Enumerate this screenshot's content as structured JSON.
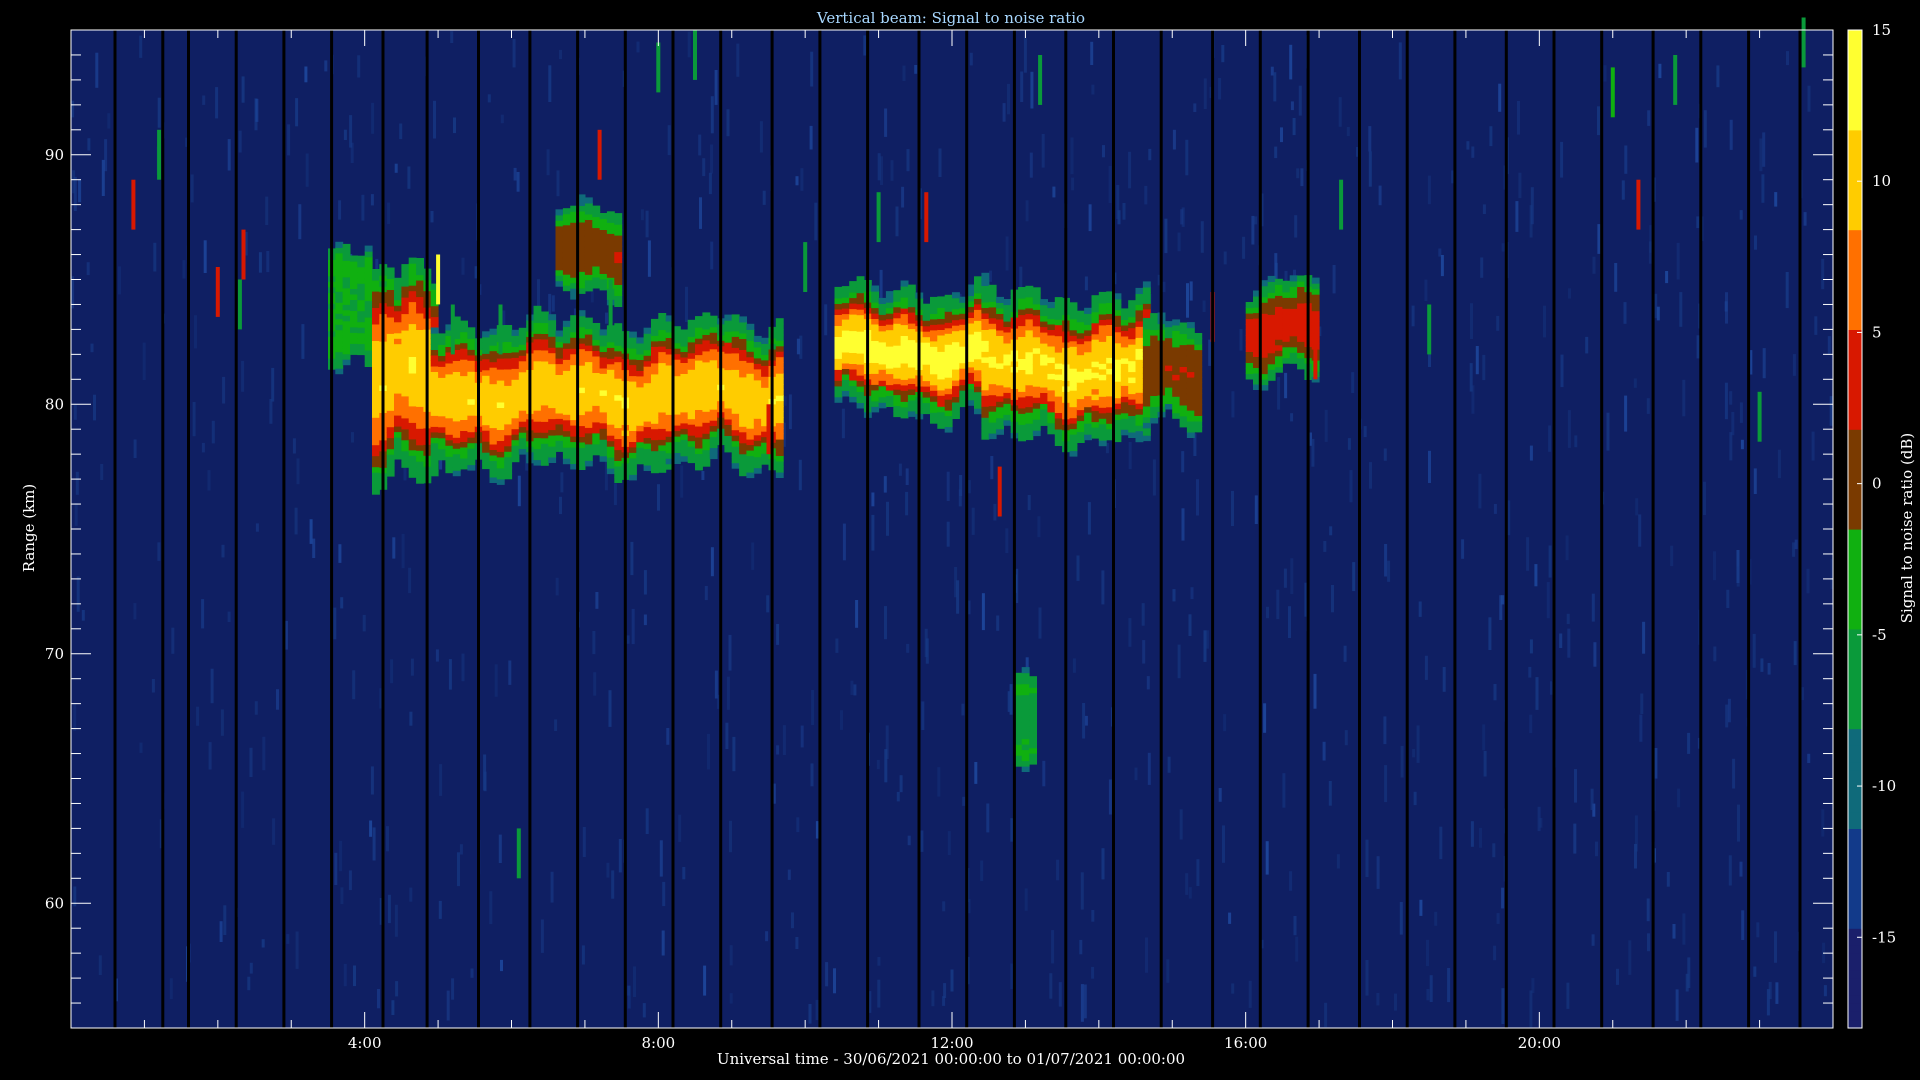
{
  "chart_data": {
    "type": "heatmap",
    "title": "Vertical beam: Signal to noise ratio",
    "xlabel": "Universal time - 30/06/2021 00:00:00 to 01/07/2021 00:00:00",
    "ylabel": "Range (km)",
    "colorbar_label": "Signal to noise ratio (dB)",
    "x_unit": "hours UT",
    "xlim": [
      0,
      24
    ],
    "ylim": [
      55,
      95
    ],
    "clim": [
      -18,
      15
    ],
    "x_ticks": [
      {
        "value": 4,
        "label": "4:00"
      },
      {
        "value": 8,
        "label": "8:00"
      },
      {
        "value": 12,
        "label": "12:00"
      },
      {
        "value": 16,
        "label": "16:00"
      },
      {
        "value": 20,
        "label": "20:00"
      }
    ],
    "y_ticks": [
      {
        "value": 60,
        "label": "60"
      },
      {
        "value": 70,
        "label": "70"
      },
      {
        "value": 80,
        "label": "80"
      },
      {
        "value": 90,
        "label": "90"
      }
    ],
    "colorbar_ticks": [
      {
        "value": 15,
        "label": "15"
      },
      {
        "value": 10,
        "label": "10"
      },
      {
        "value": 5,
        "label": "5"
      },
      {
        "value": 0,
        "label": "0"
      },
      {
        "value": -5,
        "label": "-5"
      },
      {
        "value": -10,
        "label": "-10"
      },
      {
        "value": -15,
        "label": "-15"
      }
    ],
    "colormap": [
      "#1a1f6b",
      "#123a8a",
      "#0f6a7a",
      "#0a9a3a",
      "#10b010",
      "#7a3a00",
      "#d81800",
      "#ff7000",
      "#ffcc00",
      "#ffff30"
    ],
    "background_color": "#0f1f63",
    "data_gaps_hours": [
      0.6,
      1.25,
      1.6,
      2.25,
      2.9,
      3.55,
      4.25,
      4.85,
      5.55,
      6.25,
      6.9,
      7.55,
      8.2,
      8.85,
      9.55,
      10.2,
      10.85,
      11.55,
      12.2,
      12.85,
      13.55,
      14.2,
      14.85,
      15.55,
      16.2,
      16.85,
      17.55,
      18.2,
      18.85,
      19.55,
      20.2,
      20.85,
      21.55,
      22.2,
      22.85,
      23.55
    ],
    "echo_regions": [
      {
        "t_start": 3.5,
        "t_end": 4.1,
        "range_center": 84.0,
        "half_thickness": 1.6,
        "peak_snr": -4
      },
      {
        "t_start": 4.1,
        "t_end": 4.9,
        "range_center": 81.0,
        "half_thickness": 3.2,
        "peak_snr": 12
      },
      {
        "t_start": 4.9,
        "t_end": 9.6,
        "range_center": 80.3,
        "half_thickness": 2.0,
        "peak_snr": 12
      },
      {
        "t_start": 6.6,
        "t_end": 7.4,
        "range_center": 86.0,
        "half_thickness": 1.2,
        "peak_snr": 2
      },
      {
        "t_start": 10.4,
        "t_end": 12.4,
        "range_center": 82.0,
        "half_thickness": 1.7,
        "peak_snr": 14
      },
      {
        "t_start": 12.4,
        "t_end": 14.6,
        "range_center": 81.4,
        "half_thickness": 2.0,
        "peak_snr": 13
      },
      {
        "t_start": 14.6,
        "t_end": 15.3,
        "range_center": 81.0,
        "half_thickness": 1.4,
        "peak_snr": 2
      },
      {
        "t_start": 16.0,
        "t_end": 16.95,
        "range_center": 82.8,
        "half_thickness": 1.3,
        "peak_snr": 5
      },
      {
        "t_start": 12.85,
        "t_end": 13.05,
        "range_center": 67.0,
        "half_thickness": 1.2,
        "peak_snr": -6
      }
    ],
    "meteor_streaks": [
      {
        "t": 0.85,
        "range": 88.0,
        "snr": 3
      },
      {
        "t": 1.2,
        "range": 90.0,
        "snr": -6
      },
      {
        "t": 2.0,
        "range": 84.5,
        "snr": 3
      },
      {
        "t": 2.35,
        "range": 86.0,
        "snr": 3
      },
      {
        "t": 2.3,
        "range": 84.0,
        "snr": -6
      },
      {
        "t": 5.0,
        "range": 85.0,
        "snr": 13
      },
      {
        "t": 5.2,
        "range": 83.0,
        "snr": -6
      },
      {
        "t": 5.85,
        "range": 83.0,
        "snr": -6
      },
      {
        "t": 7.2,
        "range": 90.0,
        "snr": 3
      },
      {
        "t": 7.35,
        "range": 84.0,
        "snr": -6
      },
      {
        "t": 8.0,
        "range": 93.5,
        "snr": -6
      },
      {
        "t": 8.5,
        "range": 94.0,
        "snr": -6
      },
      {
        "t": 9.5,
        "range": 79.0,
        "snr": 3
      },
      {
        "t": 10.0,
        "range": 85.5,
        "snr": -6
      },
      {
        "t": 11.0,
        "range": 87.5,
        "snr": -6
      },
      {
        "t": 11.65,
        "range": 87.5,
        "snr": 3
      },
      {
        "t": 12.65,
        "range": 76.5,
        "snr": 2
      },
      {
        "t": 13.2,
        "range": 93.0,
        "snr": -8
      },
      {
        "t": 15.55,
        "range": 83.5,
        "snr": 2
      },
      {
        "t": 16.95,
        "range": 82.0,
        "snr": 2
      },
      {
        "t": 17.3,
        "range": 88.0,
        "snr": -6
      },
      {
        "t": 18.5,
        "range": 83.0,
        "snr": -6
      },
      {
        "t": 21.0,
        "range": 92.5,
        "snr": -4
      },
      {
        "t": 21.35,
        "range": 88.0,
        "snr": 5
      },
      {
        "t": 21.85,
        "range": 93.0,
        "snr": -6
      },
      {
        "t": 6.1,
        "range": 62.0,
        "snr": -7
      },
      {
        "t": 23.0,
        "range": 79.5,
        "snr": -7
      },
      {
        "t": 23.6,
        "range": 94.5,
        "snr": -7
      }
    ]
  }
}
